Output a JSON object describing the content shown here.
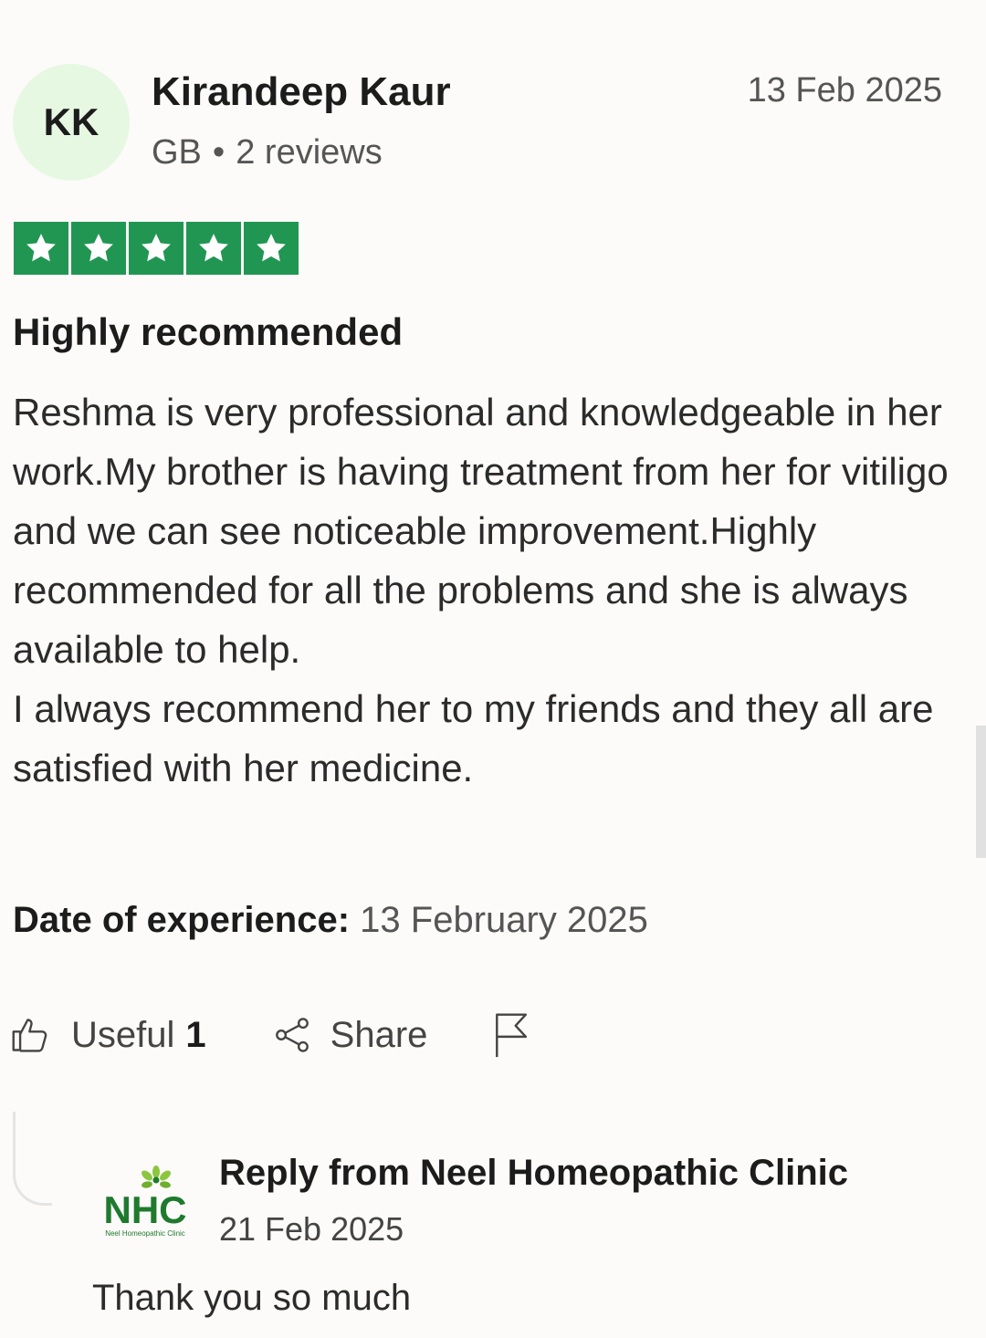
{
  "review": {
    "avatar_initials": "KK",
    "reviewer_name": "Kirandeep Kaur",
    "country": "GB",
    "separator": "•",
    "review_count": "2 reviews",
    "date": "13 Feb 2025",
    "rating": "5",
    "title": "Highly recommended",
    "body_paragraph_1": "Reshma is very professional and knowledgeable in her work.My brother is having treatment from her for vitiligo and we can see noticeable improvement.Highly recommended for all the problems and she is always available to help.",
    "body_paragraph_2": "I always recommend her to my friends and they all are satisfied with her medicine.",
    "experience_label": "Date of experience:",
    "experience_date": "13 February 2025"
  },
  "actions": {
    "useful_label": "Useful",
    "useful_count": "1",
    "share_label": "Share",
    "useful_icon": "thumbs-up-icon",
    "share_icon": "share-icon",
    "report_icon": "flag-icon"
  },
  "reply": {
    "title": "Reply from Neel Homeopathic Clinic",
    "date": "21 Feb 2025",
    "body": "Thank you so much",
    "logo_text": "NHC",
    "logo_subtext": "Neel Homeopathic Clinic"
  },
  "colors": {
    "star_green": "#219653",
    "avatar_bg": "#e6f8e1",
    "logo_green": "#1f7a2e",
    "logo_leaf": "#8cc63f"
  }
}
